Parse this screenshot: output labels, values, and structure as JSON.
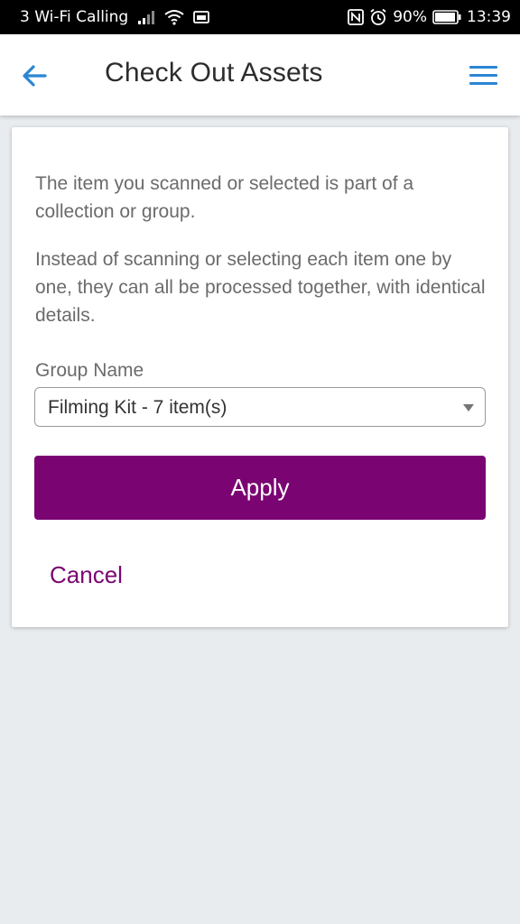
{
  "status_bar": {
    "carrier": "3 Wi-Fi Calling",
    "battery_percent": "90%",
    "time": "13:39",
    "icons": [
      "signal-icon",
      "wifi-icon",
      "sim-card-icon",
      "nfc-icon",
      "alarm-icon",
      "battery-icon"
    ]
  },
  "header": {
    "title": "Check Out Assets",
    "back_icon": "arrow-left-icon",
    "menu_icon": "hamburger-menu-icon",
    "accent_color": "#2a86d3"
  },
  "card": {
    "paragraph1": "The item you scanned or selected is part of a collection or group.",
    "paragraph2": "Instead of scanning or selecting each item one by one, they can all be processed together, with identical details.",
    "group_label": "Group Name",
    "group_selected": "Filming Kit - 7 item(s)",
    "apply_label": "Apply",
    "cancel_label": "Cancel",
    "brand_color": "#7a0572"
  }
}
